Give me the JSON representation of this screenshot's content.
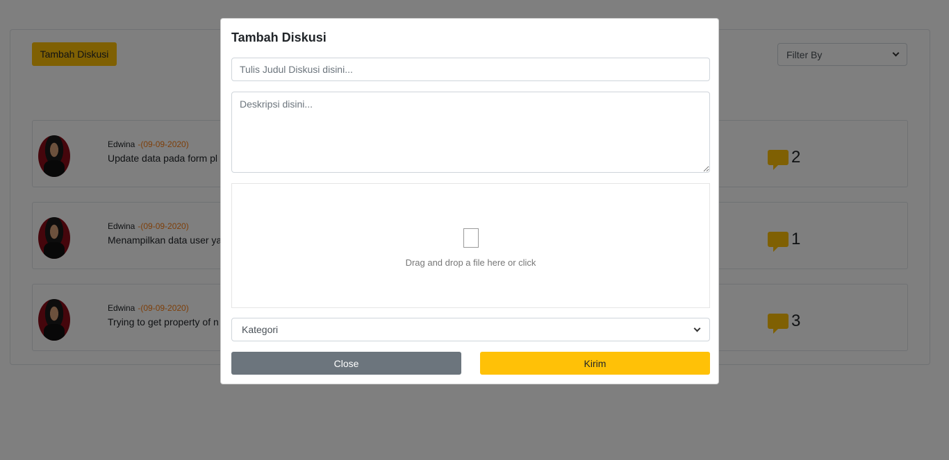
{
  "background": {
    "add_button_label": "Tambah Diskusi",
    "filter_label": "Filter By",
    "discussions": [
      {
        "author": "Edwina",
        "date": "-(09-09-2020)",
        "title": "Update data pada form pl",
        "comments": "2"
      },
      {
        "author": "Edwina",
        "date": "-(09-09-2020)",
        "title": "Menampilkan data user ya",
        "comments": "1"
      },
      {
        "author": "Edwina",
        "date": "-(09-09-2020)",
        "title": "Trying to get property of n",
        "comments": "3"
      }
    ]
  },
  "modal": {
    "title": "Tambah Diskusi",
    "title_placeholder": "Tulis Judul Diskusi disini...",
    "description_placeholder": "Deskripsi disini...",
    "dropzone_text": "Drag and drop a file here or click",
    "category_label": "Kategori",
    "close_label": "Close",
    "submit_label": "Kirim"
  },
  "colors": {
    "accent": "#ffc107",
    "secondary": "#6c757d",
    "date": "#fd7e14"
  }
}
